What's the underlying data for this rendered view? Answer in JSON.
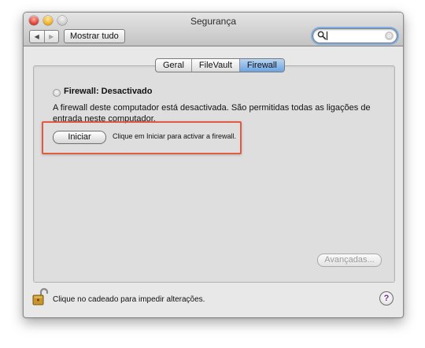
{
  "window": {
    "title": "Segurança",
    "toolbar": {
      "back_icon": "◀",
      "forward_icon": "▶",
      "show_all_label": "Mostrar tudo"
    },
    "search": {
      "value": "",
      "icon": "magnifier-icon",
      "clear_icon": "⊗"
    }
  },
  "tabs": [
    {
      "label": "Geral",
      "active": false
    },
    {
      "label": "FileVault",
      "active": false
    },
    {
      "label": "Firewall",
      "active": true
    }
  ],
  "firewall": {
    "status": "Firewall: Desactivado",
    "description": "A firewall deste computador está desactivada. São permitidas todas as ligações de entrada neste computador.",
    "start_button": "Iniciar",
    "start_hint": "Clique em Iniciar para activar a firewall.",
    "advanced_button": "Avançadas..."
  },
  "footer": {
    "lock_text": "Clique no cadeado para impedir alterações.",
    "help_label": "?"
  },
  "colors": {
    "highlight": "#e35a43",
    "active_tab": "#6aa4e3"
  }
}
